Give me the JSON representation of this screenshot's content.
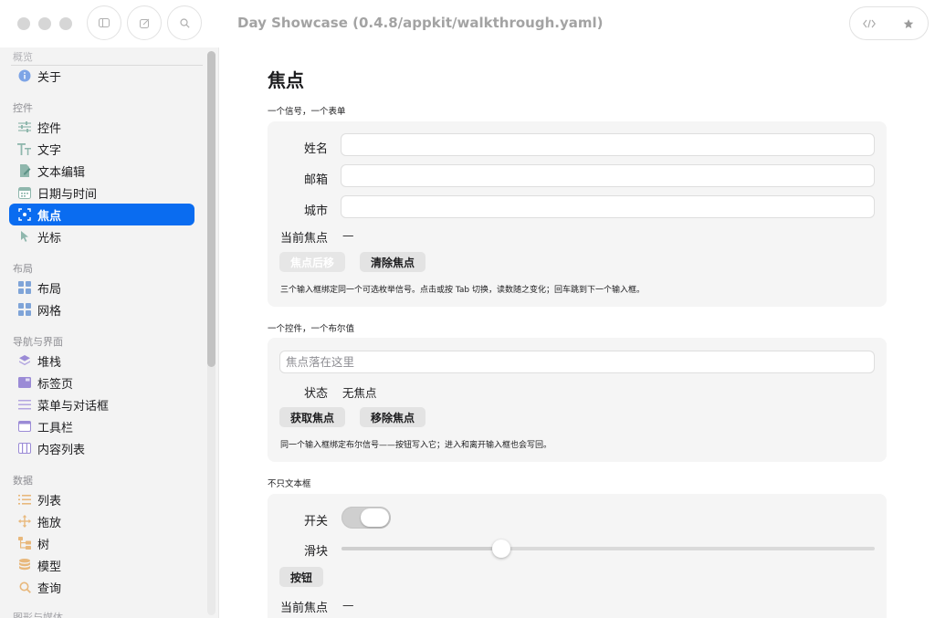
{
  "window": {
    "title": "Day Showcase (0.4.8/appkit/walkthrough.yaml)"
  },
  "sidebar": {
    "top_section": "概览",
    "about": "关于",
    "sections": [
      {
        "title": "控件",
        "items": [
          {
            "label": "控件",
            "icon": "sliders-icon"
          },
          {
            "label": "文字",
            "icon": "text-size-icon"
          },
          {
            "label": "文本编辑",
            "icon": "edit-document-icon"
          },
          {
            "label": "日期与时间",
            "icon": "calendar-icon"
          },
          {
            "label": "焦点",
            "icon": "focus-icon",
            "active": true
          },
          {
            "label": "光标",
            "icon": "cursor-icon"
          }
        ]
      },
      {
        "title": "布局",
        "items": [
          {
            "label": "布局",
            "icon": "layout-icon"
          },
          {
            "label": "网格",
            "icon": "grid-icon"
          }
        ]
      },
      {
        "title": "导航与界面",
        "items": [
          {
            "label": "堆栈",
            "icon": "stack-icon"
          },
          {
            "label": "标签页",
            "icon": "tabs-icon"
          },
          {
            "label": "菜单与对话框",
            "icon": "menu-icon"
          },
          {
            "label": "工具栏",
            "icon": "toolbar-icon"
          },
          {
            "label": "内容列表",
            "icon": "columns-icon"
          }
        ]
      },
      {
        "title": "数据",
        "items": [
          {
            "label": "列表",
            "icon": "list-icon"
          },
          {
            "label": "拖放",
            "icon": "move-icon"
          },
          {
            "label": "树",
            "icon": "tree-icon"
          },
          {
            "label": "模型",
            "icon": "database-icon"
          },
          {
            "label": "查询",
            "icon": "search-icon"
          }
        ]
      }
    ],
    "cut_section": "图形与媒体"
  },
  "page": {
    "title": "焦点",
    "section1": {
      "title": "一个信号，一个表单",
      "fields": [
        {
          "label": "姓名",
          "value": ""
        },
        {
          "label": "邮箱",
          "value": ""
        },
        {
          "label": "城市",
          "value": ""
        }
      ],
      "current_focus_label": "当前焦点",
      "current_focus_value": "—",
      "button_next": "焦点后移",
      "button_clear": "清除焦点",
      "note": "三个输入框绑定同一个可选枚举信号。点击或按 Tab 切换，读数随之变化；回车跳到下一个输入框。"
    },
    "section2": {
      "title": "一个控件，一个布尔值",
      "placeholder": "焦点落在这里",
      "status_label": "状态",
      "status_value": "无焦点",
      "button_get": "获取焦点",
      "button_remove": "移除焦点",
      "note": "同一个输入框绑定布尔信号——按钮写入它；进入和离开输入框也会写回。"
    },
    "section3": {
      "title": "不只文本框",
      "switch_label": "开关",
      "switch_on": true,
      "slider_label": "滑块",
      "slider_value": 0.3,
      "button_label": "按钮",
      "current_focus_label": "当前焦点",
      "current_focus_value": "—"
    }
  }
}
